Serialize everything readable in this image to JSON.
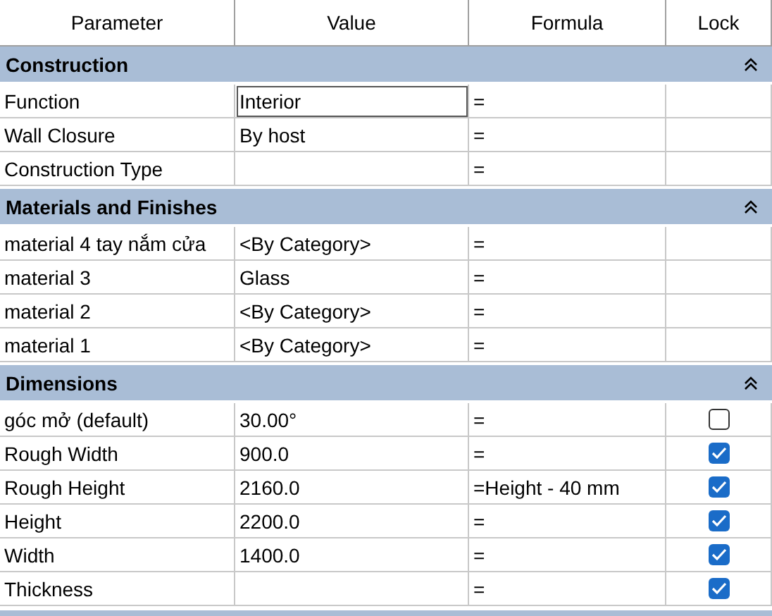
{
  "columns": [
    "Parameter",
    "Value",
    "Formula",
    "Lock"
  ],
  "groups": [
    {
      "title": "Construction",
      "expanded": true,
      "rows": [
        {
          "name": "Function",
          "value": "Interior",
          "formula": "=",
          "selected": true
        },
        {
          "name": "Wall Closure",
          "value": "By host",
          "formula": "=",
          "selected": false
        },
        {
          "name": "Construction Type",
          "value": "",
          "formula": "=",
          "selected": false
        }
      ]
    },
    {
      "title": "Materials and Finishes",
      "expanded": true,
      "rows": [
        {
          "name": "material 4 tay nắm cửa",
          "value": "<By Category>",
          "formula": "=",
          "selected": false
        },
        {
          "name": "material 3",
          "value": "Glass",
          "formula": "=",
          "selected": false
        },
        {
          "name": "material 2",
          "value": "<By Category>",
          "formula": "=",
          "selected": false
        },
        {
          "name": "material 1",
          "value": "<By Category>",
          "formula": "=",
          "selected": false
        }
      ]
    },
    {
      "title": "Dimensions",
      "expanded": true,
      "rows": [
        {
          "name": "góc mở (default)",
          "value": "30.00°",
          "formula": "=",
          "selected": false,
          "locked": false
        },
        {
          "name": "Rough Width",
          "value": "900.0",
          "formula": "=",
          "selected": false,
          "locked": true
        },
        {
          "name": "Rough Height",
          "value": "2160.0",
          "formula": "=Height - 40 mm",
          "selected": false,
          "locked": true
        },
        {
          "name": "Height",
          "value": "2200.0",
          "formula": "=",
          "selected": false,
          "locked": true
        },
        {
          "name": "Width",
          "value": "1400.0",
          "formula": "=",
          "selected": false,
          "locked": true
        },
        {
          "name": "Thickness",
          "value": "",
          "formula": "=",
          "selected": false,
          "locked": true
        }
      ]
    }
  ]
}
